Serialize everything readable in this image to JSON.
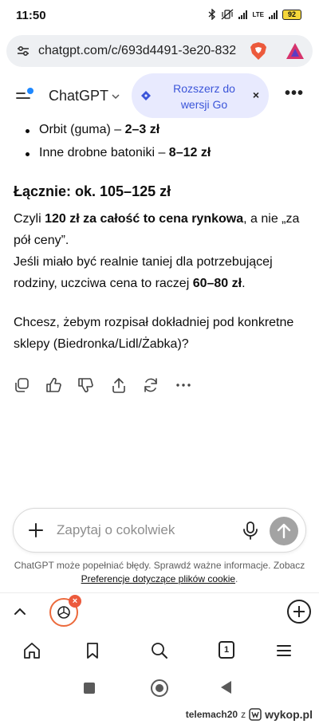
{
  "status_bar": {
    "time": "11:50",
    "network_label": "LTE",
    "battery": "92"
  },
  "browser": {
    "url": "chatgpt.com/c/693d4491-3e20-832"
  },
  "header": {
    "title": "ChatGPT",
    "upgrade_label": "Rozszerz do wersji Go",
    "upgrade_close": "×"
  },
  "message": {
    "bullets": [
      {
        "text": "Orbit (guma) – ",
        "value": "2–3 zł"
      },
      {
        "text": "Inne drobne batoniki – ",
        "value": "8–12 zł"
      }
    ],
    "total": "Łącznie: ok. 105–125 zł",
    "para1": {
      "prefix": "Czyli ",
      "bold": "120 zł za całość to cena rynkowa",
      "suffix": ", a nie „za pół ceny”."
    },
    "para2": {
      "prefix": "Jeśli miało być realnie taniej dla potrzebującej rodziny, uczciwa cena to raczej ",
      "bold": "60–80 zł",
      "suffix": "."
    },
    "question": "Chcesz, żebym rozpisał dokładniej pod konkretne sklepy (Biedronka/Lidl/Żabka)?"
  },
  "composer": {
    "placeholder": "Zapytaj o cokolwiek"
  },
  "disclaimer": {
    "text": "ChatGPT może popełniać błędy. Sprawdź ważne informacje. Zobacz ",
    "link": "Preferencje dotyczące plików cookie",
    "suffix": "."
  },
  "tab_strip": {
    "close_badge": "×"
  },
  "toolbar": {
    "tab_count": "1"
  },
  "watermark": {
    "user": "telemach20",
    "separator": "z",
    "site": "wykop.pl"
  },
  "colors": {
    "accent_blue": "#3b55d9",
    "pill_bg": "#e8eafe",
    "brave_orange": "#ec5a3c",
    "send_disabled": "#a3a3a3"
  }
}
